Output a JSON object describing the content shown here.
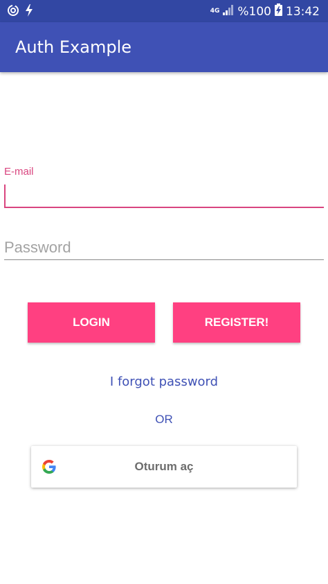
{
  "status_bar": {
    "network": "4G",
    "battery": "%100",
    "time": "13:42",
    "icons": [
      "sync-icon",
      "flash-icon",
      "signal-icon",
      "battery-charging-icon"
    ]
  },
  "app_bar": {
    "title": "Auth Example",
    "color": "#3f51b5"
  },
  "form": {
    "email_label": "E-mail",
    "email_value": "",
    "password_placeholder": "Password",
    "accent_color": "#d9457f"
  },
  "buttons": {
    "login_label": "LOGIN",
    "register_label": "REGISTER!",
    "color": "#ff4081"
  },
  "links": {
    "forgot_password": "I forgot password",
    "or_separator": "OR"
  },
  "google_sign_in": {
    "label": "Oturum aç",
    "icon": "google-icon"
  }
}
